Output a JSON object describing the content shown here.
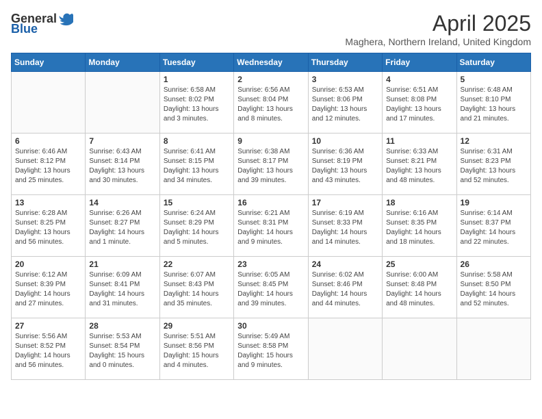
{
  "header": {
    "logo_general": "General",
    "logo_blue": "Blue",
    "title": "April 2025",
    "subtitle": "Maghera, Northern Ireland, United Kingdom"
  },
  "weekdays": [
    "Sunday",
    "Monday",
    "Tuesday",
    "Wednesday",
    "Thursday",
    "Friday",
    "Saturday"
  ],
  "weeks": [
    [
      {
        "day": "",
        "sunrise": "",
        "sunset": "",
        "daylight": ""
      },
      {
        "day": "",
        "sunrise": "",
        "sunset": "",
        "daylight": ""
      },
      {
        "day": "1",
        "sunrise": "Sunrise: 6:58 AM",
        "sunset": "Sunset: 8:02 PM",
        "daylight": "Daylight: 13 hours and 3 minutes."
      },
      {
        "day": "2",
        "sunrise": "Sunrise: 6:56 AM",
        "sunset": "Sunset: 8:04 PM",
        "daylight": "Daylight: 13 hours and 8 minutes."
      },
      {
        "day": "3",
        "sunrise": "Sunrise: 6:53 AM",
        "sunset": "Sunset: 8:06 PM",
        "daylight": "Daylight: 13 hours and 12 minutes."
      },
      {
        "day": "4",
        "sunrise": "Sunrise: 6:51 AM",
        "sunset": "Sunset: 8:08 PM",
        "daylight": "Daylight: 13 hours and 17 minutes."
      },
      {
        "day": "5",
        "sunrise": "Sunrise: 6:48 AM",
        "sunset": "Sunset: 8:10 PM",
        "daylight": "Daylight: 13 hours and 21 minutes."
      }
    ],
    [
      {
        "day": "6",
        "sunrise": "Sunrise: 6:46 AM",
        "sunset": "Sunset: 8:12 PM",
        "daylight": "Daylight: 13 hours and 25 minutes."
      },
      {
        "day": "7",
        "sunrise": "Sunrise: 6:43 AM",
        "sunset": "Sunset: 8:14 PM",
        "daylight": "Daylight: 13 hours and 30 minutes."
      },
      {
        "day": "8",
        "sunrise": "Sunrise: 6:41 AM",
        "sunset": "Sunset: 8:15 PM",
        "daylight": "Daylight: 13 hours and 34 minutes."
      },
      {
        "day": "9",
        "sunrise": "Sunrise: 6:38 AM",
        "sunset": "Sunset: 8:17 PM",
        "daylight": "Daylight: 13 hours and 39 minutes."
      },
      {
        "day": "10",
        "sunrise": "Sunrise: 6:36 AM",
        "sunset": "Sunset: 8:19 PM",
        "daylight": "Daylight: 13 hours and 43 minutes."
      },
      {
        "day": "11",
        "sunrise": "Sunrise: 6:33 AM",
        "sunset": "Sunset: 8:21 PM",
        "daylight": "Daylight: 13 hours and 48 minutes."
      },
      {
        "day": "12",
        "sunrise": "Sunrise: 6:31 AM",
        "sunset": "Sunset: 8:23 PM",
        "daylight": "Daylight: 13 hours and 52 minutes."
      }
    ],
    [
      {
        "day": "13",
        "sunrise": "Sunrise: 6:28 AM",
        "sunset": "Sunset: 8:25 PM",
        "daylight": "Daylight: 13 hours and 56 minutes."
      },
      {
        "day": "14",
        "sunrise": "Sunrise: 6:26 AM",
        "sunset": "Sunset: 8:27 PM",
        "daylight": "Daylight: 14 hours and 1 minute."
      },
      {
        "day": "15",
        "sunrise": "Sunrise: 6:24 AM",
        "sunset": "Sunset: 8:29 PM",
        "daylight": "Daylight: 14 hours and 5 minutes."
      },
      {
        "day": "16",
        "sunrise": "Sunrise: 6:21 AM",
        "sunset": "Sunset: 8:31 PM",
        "daylight": "Daylight: 14 hours and 9 minutes."
      },
      {
        "day": "17",
        "sunrise": "Sunrise: 6:19 AM",
        "sunset": "Sunset: 8:33 PM",
        "daylight": "Daylight: 14 hours and 14 minutes."
      },
      {
        "day": "18",
        "sunrise": "Sunrise: 6:16 AM",
        "sunset": "Sunset: 8:35 PM",
        "daylight": "Daylight: 14 hours and 18 minutes."
      },
      {
        "day": "19",
        "sunrise": "Sunrise: 6:14 AM",
        "sunset": "Sunset: 8:37 PM",
        "daylight": "Daylight: 14 hours and 22 minutes."
      }
    ],
    [
      {
        "day": "20",
        "sunrise": "Sunrise: 6:12 AM",
        "sunset": "Sunset: 8:39 PM",
        "daylight": "Daylight: 14 hours and 27 minutes."
      },
      {
        "day": "21",
        "sunrise": "Sunrise: 6:09 AM",
        "sunset": "Sunset: 8:41 PM",
        "daylight": "Daylight: 14 hours and 31 minutes."
      },
      {
        "day": "22",
        "sunrise": "Sunrise: 6:07 AM",
        "sunset": "Sunset: 8:43 PM",
        "daylight": "Daylight: 14 hours and 35 minutes."
      },
      {
        "day": "23",
        "sunrise": "Sunrise: 6:05 AM",
        "sunset": "Sunset: 8:45 PM",
        "daylight": "Daylight: 14 hours and 39 minutes."
      },
      {
        "day": "24",
        "sunrise": "Sunrise: 6:02 AM",
        "sunset": "Sunset: 8:46 PM",
        "daylight": "Daylight: 14 hours and 44 minutes."
      },
      {
        "day": "25",
        "sunrise": "Sunrise: 6:00 AM",
        "sunset": "Sunset: 8:48 PM",
        "daylight": "Daylight: 14 hours and 48 minutes."
      },
      {
        "day": "26",
        "sunrise": "Sunrise: 5:58 AM",
        "sunset": "Sunset: 8:50 PM",
        "daylight": "Daylight: 14 hours and 52 minutes."
      }
    ],
    [
      {
        "day": "27",
        "sunrise": "Sunrise: 5:56 AM",
        "sunset": "Sunset: 8:52 PM",
        "daylight": "Daylight: 14 hours and 56 minutes."
      },
      {
        "day": "28",
        "sunrise": "Sunrise: 5:53 AM",
        "sunset": "Sunset: 8:54 PM",
        "daylight": "Daylight: 15 hours and 0 minutes."
      },
      {
        "day": "29",
        "sunrise": "Sunrise: 5:51 AM",
        "sunset": "Sunset: 8:56 PM",
        "daylight": "Daylight: 15 hours and 4 minutes."
      },
      {
        "day": "30",
        "sunrise": "Sunrise: 5:49 AM",
        "sunset": "Sunset: 8:58 PM",
        "daylight": "Daylight: 15 hours and 9 minutes."
      },
      {
        "day": "",
        "sunrise": "",
        "sunset": "",
        "daylight": ""
      },
      {
        "day": "",
        "sunrise": "",
        "sunset": "",
        "daylight": ""
      },
      {
        "day": "",
        "sunrise": "",
        "sunset": "",
        "daylight": ""
      }
    ]
  ]
}
